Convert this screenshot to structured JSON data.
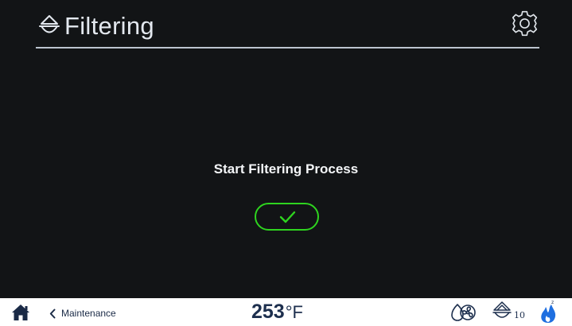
{
  "header": {
    "title": "Filtering",
    "title_icon": "filter-drop-icon",
    "settings_icon": "gear-icon"
  },
  "main": {
    "prompt": "Start Filtering Process",
    "confirm_icon": "checkmark-icon"
  },
  "bottom_bar": {
    "home_icon": "home-icon",
    "back_label": "Maintenance",
    "temperature": {
      "value": "253",
      "unit": "°F"
    },
    "status_icons": [
      "fan-status-icon",
      "filter-status-icon",
      "flame-status-icon"
    ],
    "filter_count": "10"
  },
  "colors": {
    "background": "#121416",
    "header_text": "#e3e8ef",
    "divider": "#bcc4cf",
    "confirm_accent": "#2ed41f",
    "bottom_bar_bg": "#ffffff",
    "bottom_bar_text": "#1d2f4e",
    "flame_blue": "#1f6fe0"
  }
}
